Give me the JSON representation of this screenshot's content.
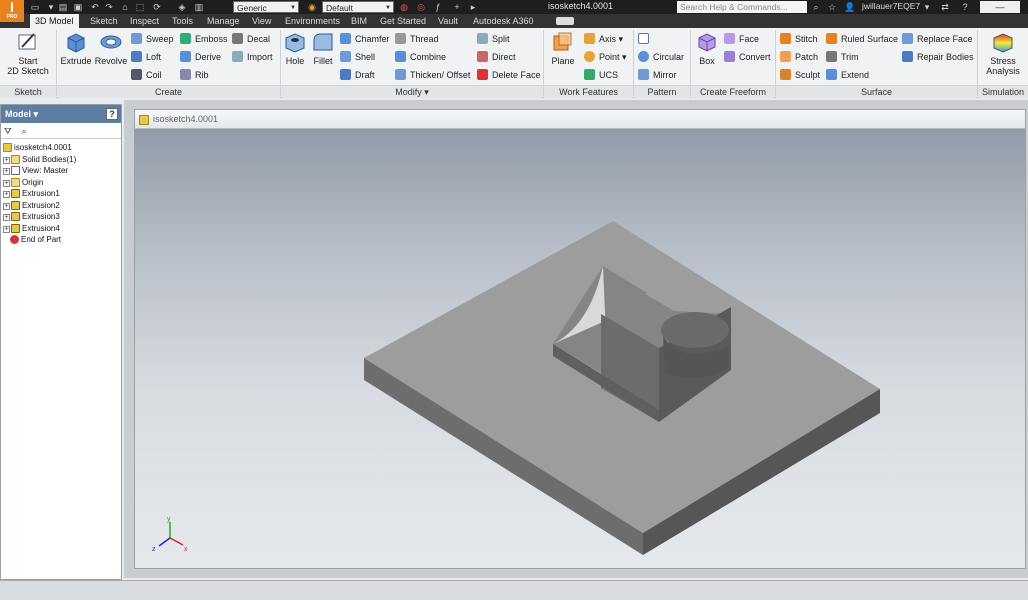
{
  "app": {
    "logo_text": "I",
    "logo_sub": "PRO",
    "title": "isosketch4.0001",
    "material_combo": "Generic",
    "appearance_combo": "Default",
    "search_placeholder": "Search Help & Commands...",
    "user": "jwillauer7EQE7"
  },
  "tabs": [
    "3D Model",
    "Sketch",
    "Inspect",
    "Tools",
    "Manage",
    "View",
    "Environments",
    "BIM",
    "Get Started",
    "Vault",
    "Autodesk A360"
  ],
  "active_tab": "3D Model",
  "ribbon": {
    "panels": {
      "sketch": "Sketch",
      "create": "Create",
      "modify": "Modify",
      "work_features": "Work Features",
      "pattern": "Pattern",
      "create_freeform": "Create Freeform",
      "surface": "Surface",
      "simulation": "Simulation"
    },
    "start_sketch": {
      "line1": "Start",
      "line2": "2D Sketch"
    },
    "create": {
      "extrude": "Extrude",
      "revolve": "Revolve",
      "sweep": "Sweep",
      "loft": "Loft",
      "coil": "Coil",
      "emboss": "Emboss",
      "derive": "Derive",
      "rib": "Rib",
      "decal": "Decal",
      "import": "Import"
    },
    "modify": {
      "hole": "Hole",
      "fillet": "Fillet",
      "chamfer": "Chamfer",
      "shell": "Shell",
      "draft": "Draft",
      "thread": "Thread",
      "combine": "Combine",
      "thicken": "Thicken/ Offset",
      "split": "Split",
      "direct": "Direct",
      "delete_face": "Delete Face"
    },
    "work": {
      "plane": "Plane",
      "axis": "Axis",
      "point": "Point",
      "ucs": "UCS"
    },
    "pattern": {
      "circular": "Circular",
      "mirror": "Mirror"
    },
    "freeform": {
      "box": "Box",
      "face": "Face",
      "convert": "Convert"
    },
    "surface": {
      "stitch": "Stitch",
      "patch": "Patch",
      "sculpt": "Sculpt",
      "ruled": "Ruled Surface",
      "trim": "Trim",
      "extend": "Extend",
      "replace": "Replace Face",
      "repair": "Repair Bodies"
    },
    "simulation": {
      "line1": "Stress",
      "line2": "Analysis"
    }
  },
  "browser": {
    "header": "Model",
    "items": [
      {
        "label": "isosketch4.0001",
        "expander": ""
      },
      {
        "label": "Solid Bodies(1)",
        "expander": "+"
      },
      {
        "label": "View: Master",
        "expander": "+"
      },
      {
        "label": "Origin",
        "expander": "+"
      },
      {
        "label": "Extrusion1",
        "expander": "+"
      },
      {
        "label": "Extrusion2",
        "expander": "+"
      },
      {
        "label": "Extrusion3",
        "expander": "+"
      },
      {
        "label": "Extrusion4",
        "expander": "+"
      },
      {
        "label": "End of Part",
        "expander": ""
      }
    ]
  },
  "viewport": {
    "doc_tab": "isosketch4.0001"
  },
  "triad": {
    "x": "x",
    "y": "y",
    "z": "z"
  },
  "colors": {
    "accent": "#e8821e",
    "model_top": "#9c9c9c",
    "model_side": "#6f6f6f"
  }
}
